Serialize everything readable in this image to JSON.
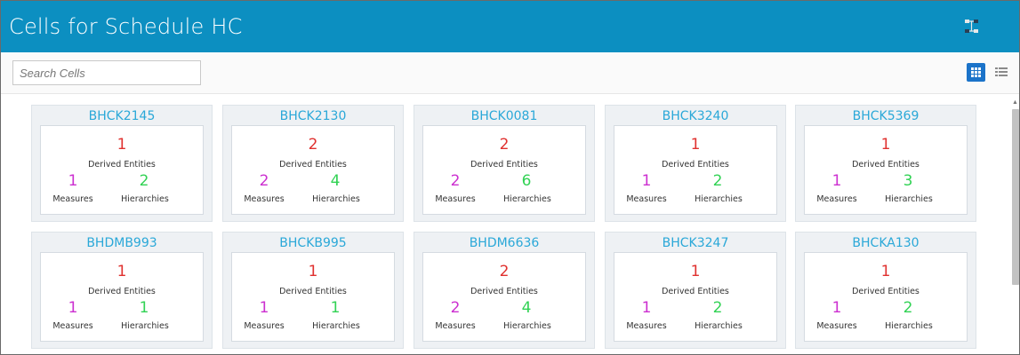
{
  "header": {
    "title": "Cells for Schedule HC",
    "icon": "network-icon"
  },
  "search": {
    "placeholder": "Search Cells"
  },
  "view": {
    "active": "grid"
  },
  "labels": {
    "derived": "Derived Entities",
    "measures": "Measures",
    "hierarchies": "Hierarchies"
  },
  "colors": {
    "header_bg": "#0c8fc1",
    "title": "#2aa8d8",
    "derived": "#e0312f",
    "measures": "#cc2fd0",
    "hierarchies": "#31d254",
    "grid_active": "#1b73c9"
  },
  "cells": [
    {
      "name": "BHCK2145",
      "derived": "1",
      "measures": "1",
      "hierarchies": "2"
    },
    {
      "name": "BHCK2130",
      "derived": "2",
      "measures": "2",
      "hierarchies": "4"
    },
    {
      "name": "BHCK0081",
      "derived": "2",
      "measures": "2",
      "hierarchies": "6"
    },
    {
      "name": "BHCK3240",
      "derived": "1",
      "measures": "1",
      "hierarchies": "2"
    },
    {
      "name": "BHCK5369",
      "derived": "1",
      "measures": "1",
      "hierarchies": "3"
    },
    {
      "name": "BHDMB993",
      "derived": "1",
      "measures": "1",
      "hierarchies": "1"
    },
    {
      "name": "BHCKB995",
      "derived": "1",
      "measures": "1",
      "hierarchies": "1"
    },
    {
      "name": "BHDM6636",
      "derived": "2",
      "measures": "2",
      "hierarchies": "4"
    },
    {
      "name": "BHCK3247",
      "derived": "1",
      "measures": "1",
      "hierarchies": "2"
    },
    {
      "name": "BHCKA130",
      "derived": "1",
      "measures": "1",
      "hierarchies": "2"
    }
  ]
}
